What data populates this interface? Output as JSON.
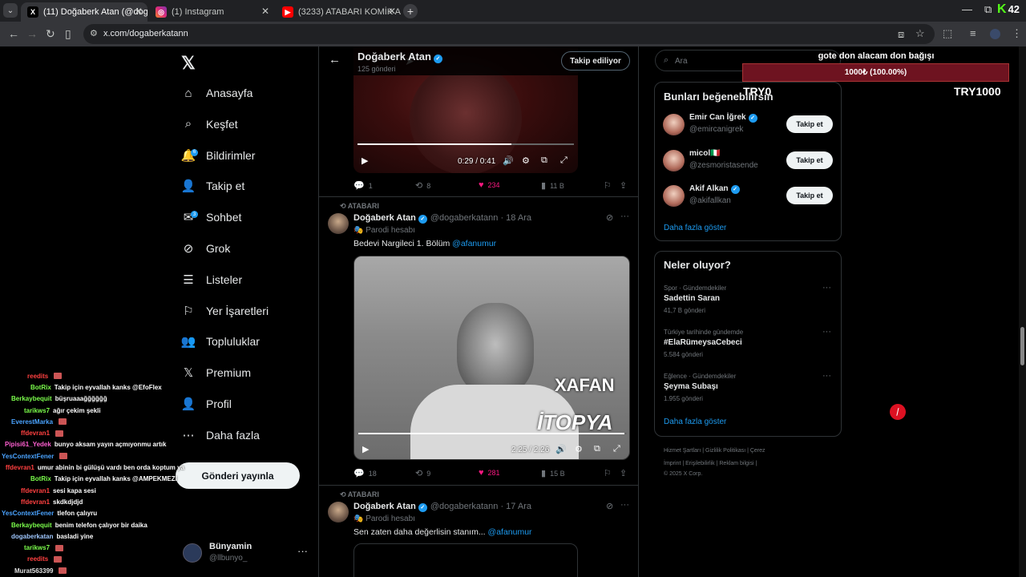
{
  "browser": {
    "tabs": [
      {
        "title": "(11) Doğaberk Atan (@dogaber",
        "active": true,
        "favicon": "X"
      },
      {
        "title": "(1) Instagram",
        "active": false,
        "favicon": "IG"
      },
      {
        "title": "(3233) ATABARI KOMİK ANLAR",
        "active": false,
        "favicon": "YT"
      }
    ],
    "url": "x.com/dogaberkatann",
    "kick_count": "42"
  },
  "nav": {
    "items": [
      {
        "label": "Anasayfa",
        "icon": "home-icon"
      },
      {
        "label": "Keşfet",
        "icon": "search-icon"
      },
      {
        "label": "Bildirimler",
        "icon": "bell-icon",
        "badge": "6"
      },
      {
        "label": "Takip et",
        "icon": "add-user-icon"
      },
      {
        "label": "Sohbet",
        "icon": "mail-icon",
        "badge": "3"
      },
      {
        "label": "Grok",
        "icon": "grok-icon"
      },
      {
        "label": "Listeler",
        "icon": "list-icon"
      },
      {
        "label": "Yer İşaretleri",
        "icon": "bookmark-icon"
      },
      {
        "label": "Topluluklar",
        "icon": "communities-icon"
      },
      {
        "label": "Premium",
        "icon": "x-premium-icon"
      },
      {
        "label": "Profil",
        "icon": "profile-icon"
      },
      {
        "label": "Daha fazla",
        "icon": "more-circle-icon"
      }
    ],
    "post_button": "Gönderi yayınla",
    "account": {
      "name": "Bünyamin",
      "handle": "@llbunyo_"
    }
  },
  "chat": [
    {
      "user": "reedits",
      "color": "#ff4040",
      "text": ""
    },
    {
      "user": "BotRix",
      "color": "#7cff4c",
      "text": "Takip için eyvallah kanks @EfoFlex"
    },
    {
      "user": "Berkaybequit",
      "color": "#7cff4c",
      "text": "büşruaaağğğğğğ"
    },
    {
      "user": "tarikws7",
      "color": "#7cff4c",
      "text": "ağır çekim şekli"
    },
    {
      "user": "EverestMarka",
      "color": "#4aa3ff",
      "text": ""
    },
    {
      "user": "ffdevran1",
      "color": "#ff4040",
      "text": ""
    },
    {
      "user": "Pipisi61_Yedek",
      "color": "#ff5fd0",
      "text": "bunyo aksam yayın açmıyonmu artık"
    },
    {
      "user": "YesContextFener",
      "color": "#4aa3ff",
      "text": ""
    },
    {
      "user": "ffdevran1",
      "color": "#ff4040",
      "text": "umur abinin bi gülüşü vardı ben orda koptum ya"
    },
    {
      "user": "BotRix",
      "color": "#7cff4c",
      "text": "Takip için eyvallah kanks @AMPEKMEZI"
    },
    {
      "user": "ffdevran1",
      "color": "#ff4040",
      "text": "sesi kapa sesi"
    },
    {
      "user": "ffdevran1",
      "color": "#ff4040",
      "text": "skdkdjdjd"
    },
    {
      "user": "YesContextFener",
      "color": "#4aa3ff",
      "text": "tlefon çalıyru"
    },
    {
      "user": "Berkaybequit",
      "color": "#7cff4c",
      "text": "benim telefon çalıyor bir daika"
    },
    {
      "user": "dogaberkatan",
      "color": "#a0c8ff",
      "text": "basladi yine"
    },
    {
      "user": "tarikws7",
      "color": "#7cff4c",
      "text": ""
    },
    {
      "user": "reedits",
      "color": "#ff4040",
      "text": ""
    },
    {
      "user": "Murat563399",
      "color": "#e0e0e0",
      "text": ""
    }
  ],
  "profile_header": {
    "name": "Doğaberk Atan",
    "posts": "125 gönderi",
    "follow_label": "Takip ediliyor"
  },
  "tweet1": {
    "time": "0:29 / 0:41",
    "progress": 0.71,
    "replies": "1",
    "reposts": "8",
    "likes": "234",
    "views": "11 B"
  },
  "tweet2": {
    "repost_by": "ATABARI",
    "name": "Doğaberk Atan",
    "handle": "@dogaberkatann",
    "date": "18 Ara",
    "parody": "Parodi hesabı",
    "text": "Bedevi Nargileci 1. Bölüm",
    "mention": "@afanumur",
    "video_overlay1": "XAFAN",
    "video_overlay2": "İTOPYA",
    "time": "2:25 / 2:26",
    "progress": 0.99,
    "replies": "18",
    "reposts": "9",
    "likes": "281",
    "views": "15 B"
  },
  "tweet3": {
    "repost_by": "ATABARI",
    "name": "Doğaberk Atan",
    "handle": "@dogaberkatann",
    "date": "17 Ara",
    "parody": "Parodi hesabı",
    "text": "Sen zaten daha değerlisin stanım...",
    "mention": "@afanumur"
  },
  "right": {
    "search_placeholder": "Ara",
    "wtf_title": "Bunları beğenebilirsin",
    "wtf": [
      {
        "name": "Emir Can İğrek",
        "handle": "@emircanigrek",
        "verified": true,
        "button": "Takip et"
      },
      {
        "name": "micol🇮🇹",
        "handle": "@zesmoristasende",
        "verified": false,
        "button": "Takip et"
      },
      {
        "name": "Akif Alkan",
        "handle": "@akifallkan",
        "verified": true,
        "button": "Takip et"
      }
    ],
    "show_more": "Daha fazla göster",
    "trends_title": "Neler oluyor?",
    "trends": [
      {
        "context": "Spor · Gündemdekiler",
        "title": "Sadettin Saran",
        "count": "41,7 B gönderi"
      },
      {
        "context": "Türkiye tarihinde gündemde",
        "title": "#ElaRümeysaCebeci",
        "count": "5.584 gönderi"
      },
      {
        "context": "Eğlence · Gündemdekiler",
        "title": "Şeyma Subaşı",
        "count": "1.955 gönderi"
      }
    ],
    "footer_line1": "Hizmet Şartları  |  Gizlilik Politikası  |  Çerez",
    "footer_line2": "İmprint  |  Erişilebilirlik  |  Reklam bilgisi  |",
    "footer_line3": "© 2025 X Corp."
  },
  "donation": {
    "title": "gote don alacam don bağışı",
    "progress_text": "1000₺ (100.00%)",
    "progress": 1.0,
    "min": "TRY0",
    "max": "TRY1000"
  }
}
